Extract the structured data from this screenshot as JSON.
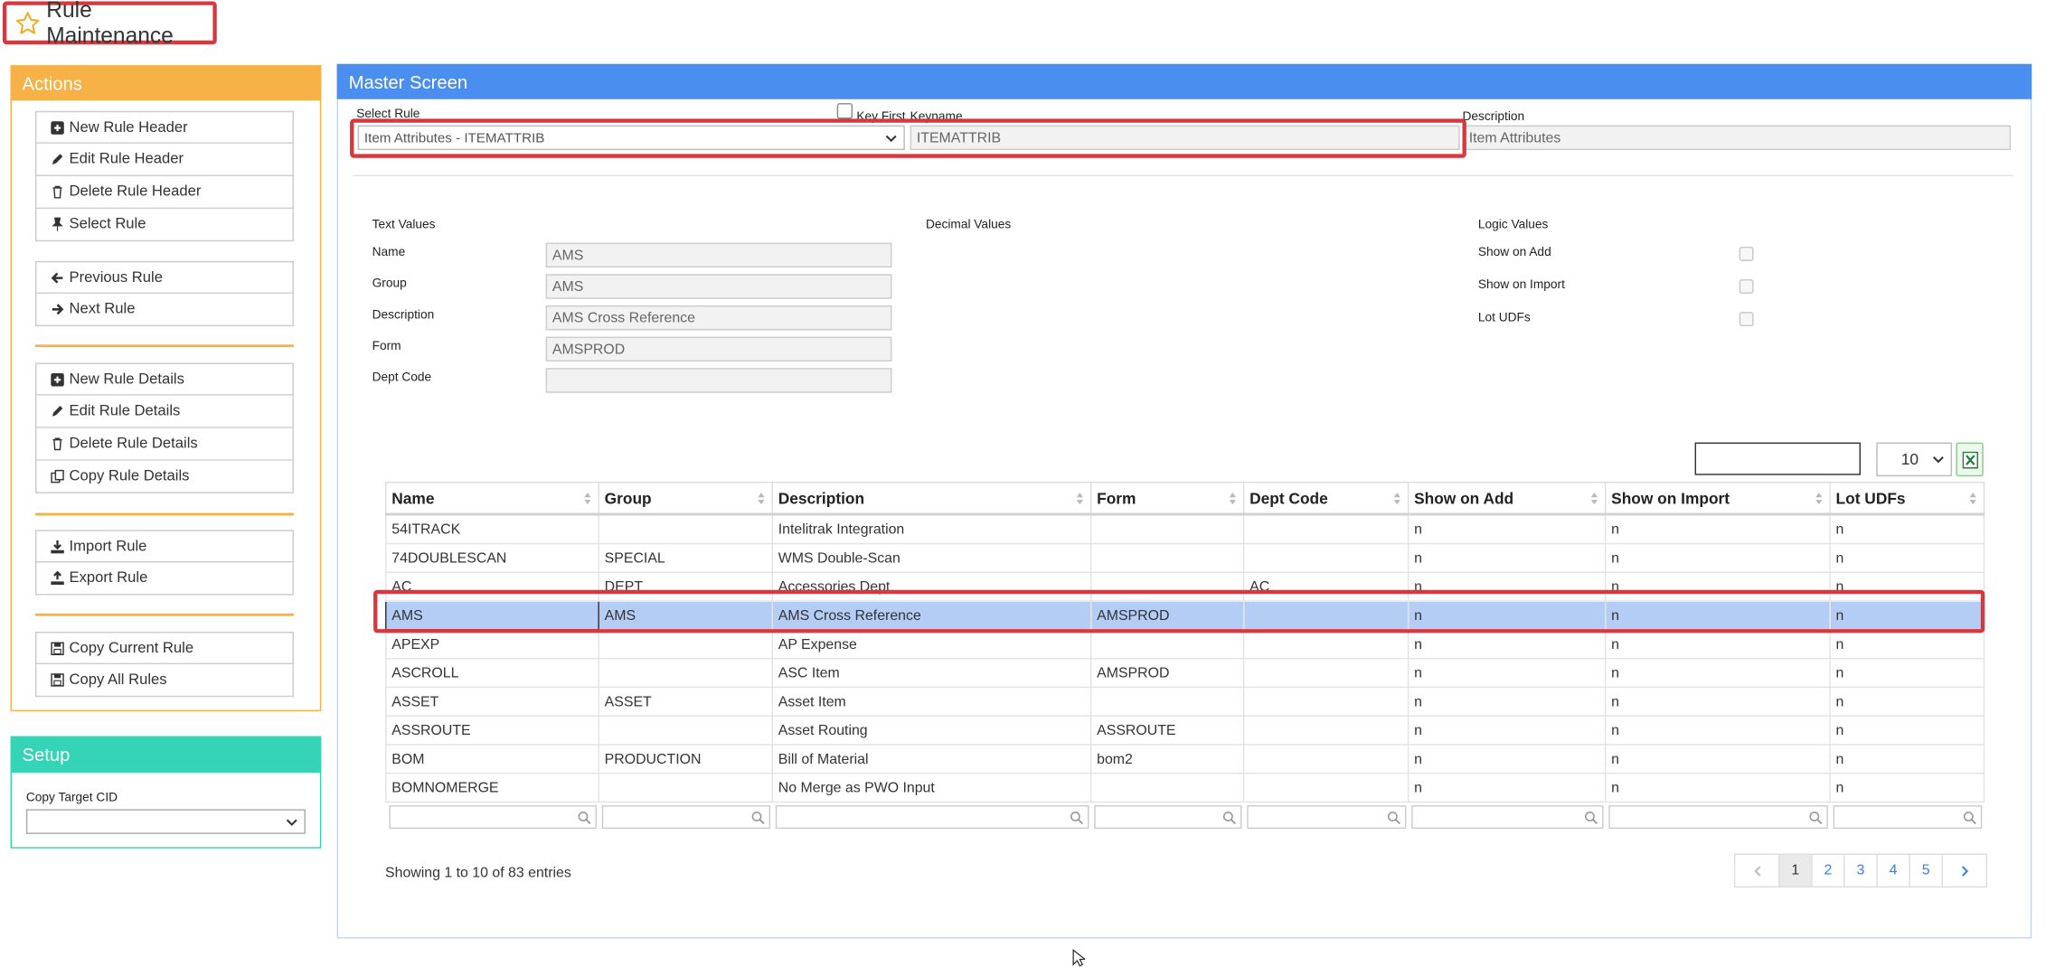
{
  "title": "Rule Maintenance",
  "actions": {
    "header": "Actions",
    "groups": [
      [
        {
          "label": "New Rule Header",
          "icon": "plus-square-icon"
        },
        {
          "label": "Edit Rule Header",
          "icon": "pencil-icon"
        },
        {
          "label": "Delete Rule Header",
          "icon": "trash-icon"
        },
        {
          "label": "Select Rule",
          "icon": "pin-icon"
        }
      ],
      [
        {
          "label": "Previous Rule",
          "icon": "arrow-left-icon"
        },
        {
          "label": "Next Rule",
          "icon": "arrow-right-icon"
        }
      ],
      [
        {
          "label": "New Rule Details",
          "icon": "plus-square-icon"
        },
        {
          "label": "Edit Rule Details",
          "icon": "pencil-icon"
        },
        {
          "label": "Delete Rule Details",
          "icon": "trash-icon"
        },
        {
          "label": "Copy Rule Details",
          "icon": "copy-icon"
        }
      ],
      [
        {
          "label": "Import Rule",
          "icon": "download-icon"
        },
        {
          "label": "Export Rule",
          "icon": "upload-icon"
        }
      ],
      [
        {
          "label": "Copy Current Rule",
          "icon": "save-icon"
        },
        {
          "label": "Copy All Rules",
          "icon": "save-icon"
        }
      ]
    ]
  },
  "setup": {
    "header": "Setup",
    "copy_target_label": "Copy Target CID",
    "copy_target_value": ""
  },
  "master": {
    "header": "Master Screen",
    "select_rule_label": "Select Rule",
    "select_rule_value": "Item Attributes - ITEMATTRIB",
    "key_first_label": "Key First",
    "keyname_label": "Keyname",
    "keyname_value": "ITEMATTRIB",
    "description_label": "Description",
    "description_value": "Item Attributes",
    "text_values_label": "Text Values",
    "decimal_values_label": "Decimal Values",
    "logic_values_label": "Logic Values",
    "text_fields": [
      {
        "label": "Name",
        "value": "AMS"
      },
      {
        "label": "Group",
        "value": "AMS"
      },
      {
        "label": "Description",
        "value": "AMS Cross Reference"
      },
      {
        "label": "Form",
        "value": "AMSPROD"
      },
      {
        "label": "Dept Code",
        "value": ""
      }
    ],
    "logic_fields": [
      {
        "label": "Show on Add",
        "checked": false
      },
      {
        "label": "Show on Import",
        "checked": false
      },
      {
        "label": "Lot UDFs",
        "checked": false
      }
    ]
  },
  "grid": {
    "search_value": "",
    "page_size": "10",
    "columns": [
      "Name",
      "Group",
      "Description",
      "Form",
      "Dept Code",
      "Show on Add",
      "Show on Import",
      "Lot UDFs"
    ],
    "rows": [
      [
        "54ITRACK",
        "",
        "Intelitrak Integration",
        "",
        "",
        "n",
        "n",
        "n"
      ],
      [
        "74DOUBLESCAN",
        "SPECIAL",
        "WMS Double-Scan",
        "",
        "",
        "n",
        "n",
        "n"
      ],
      [
        "AC",
        "DEPT",
        "Accessories Dept",
        "",
        "AC",
        "n",
        "n",
        "n"
      ],
      [
        "AMS",
        "AMS",
        "AMS Cross Reference",
        "AMSPROD",
        "",
        "n",
        "n",
        "n"
      ],
      [
        "APEXP",
        "",
        "AP Expense",
        "",
        "",
        "n",
        "n",
        "n"
      ],
      [
        "ASCROLL",
        "",
        "ASC Item",
        "AMSPROD",
        "",
        "n",
        "n",
        "n"
      ],
      [
        "ASSET",
        "ASSET",
        "Asset Item",
        "",
        "",
        "n",
        "n",
        "n"
      ],
      [
        "ASSROUTE",
        "",
        "Asset Routing",
        "ASSROUTE",
        "",
        "n",
        "n",
        "n"
      ],
      [
        "BOM",
        "PRODUCTION",
        "Bill of Material",
        "bom2",
        "",
        "n",
        "n",
        "n"
      ],
      [
        "BOMNOMERGE",
        "",
        "No Merge as PWO Input",
        "",
        "",
        "n",
        "n",
        "n"
      ]
    ],
    "selected_row": 3,
    "info": "Showing 1 to 10 of 83 entries",
    "pages": [
      "1",
      "2",
      "3",
      "4",
      "5"
    ],
    "current_page": "1"
  }
}
